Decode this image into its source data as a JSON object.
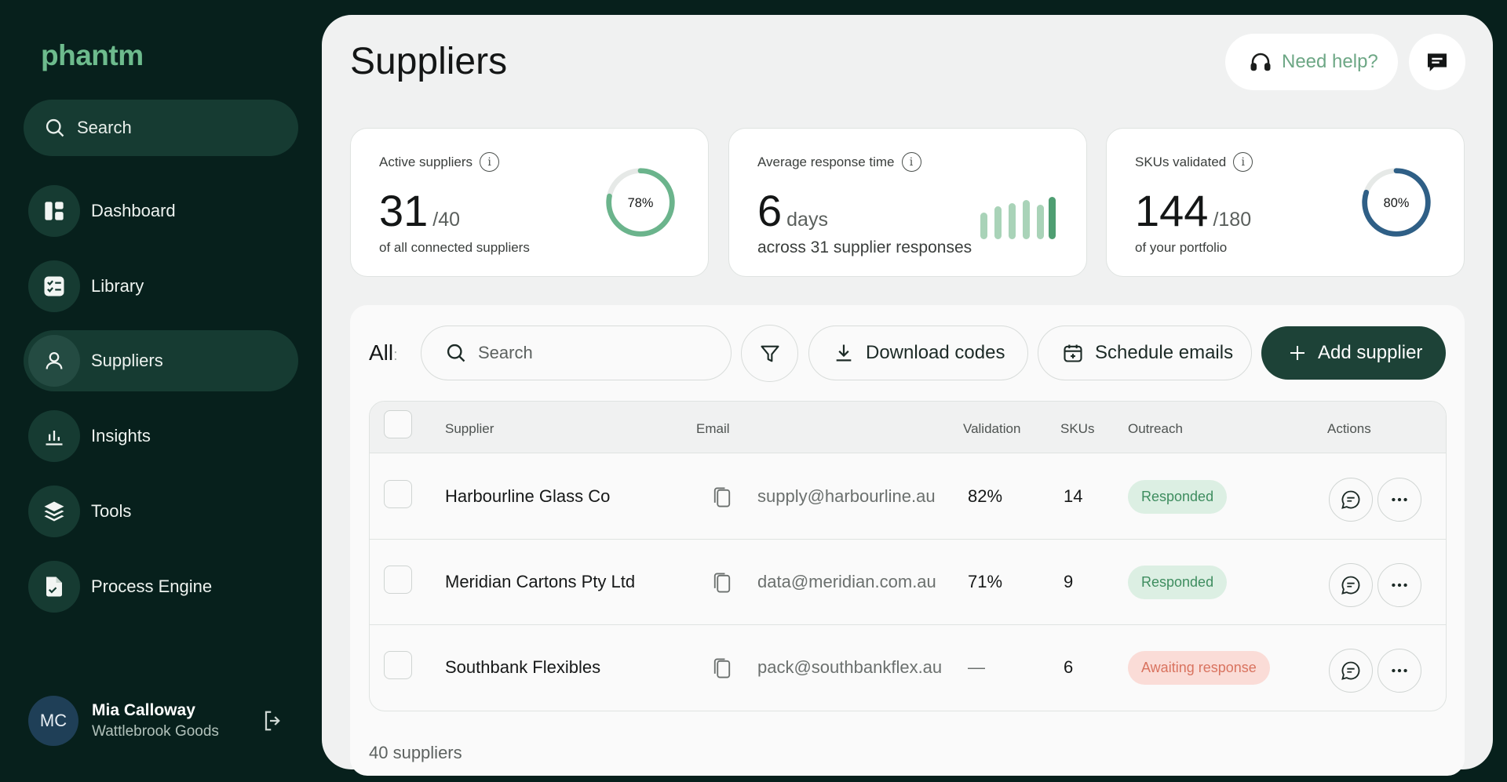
{
  "brand": {
    "logo": "phantm"
  },
  "sidebar": {
    "search_label": "Search",
    "items": [
      {
        "label": "Dashboard",
        "icon": "dashboard-icon"
      },
      {
        "label": "Library",
        "icon": "checklist-icon"
      },
      {
        "label": "Suppliers",
        "icon": "user-icon",
        "active": true
      },
      {
        "label": "Insights",
        "icon": "bar-chart-icon"
      },
      {
        "label": "Tools",
        "icon": "layers-icon"
      },
      {
        "label": "Process Engine",
        "icon": "file-check-icon"
      }
    ],
    "user": {
      "initials": "MC",
      "name": "Mia Calloway",
      "org": "Wattlebrook Goods"
    }
  },
  "header": {
    "title": "Suppliers",
    "help_label": "Need help?"
  },
  "stats": {
    "active": {
      "label": "Active suppliers",
      "value": "31",
      "denom": "/40",
      "sub": "of all connected suppliers",
      "percent_label": "78%",
      "percent": 78
    },
    "response": {
      "label": "Average response time",
      "value": "6",
      "unit": "days",
      "sub": "across 31 supplier responses"
    },
    "skus": {
      "label": "SKUs validated",
      "value": "144",
      "denom": "/180",
      "sub": "of your portfolio",
      "percent_label": "80%",
      "percent": 80
    }
  },
  "toolbar": {
    "filter_label": "All",
    "search_placeholder": "Search",
    "download_label": "Download codes",
    "schedule_label": "Schedule emails",
    "add_label": "Add supplier"
  },
  "table": {
    "headers": {
      "supplier": "Supplier",
      "email": "Email",
      "validation": "Validation",
      "skus": "SKUs",
      "outreach": "Outreach",
      "actions": "Actions"
    },
    "rows": [
      {
        "supplier": "Harbourline Glass Co",
        "email": "supply@harbourline.au",
        "validation": "82%",
        "skus": "14",
        "outreach": "Responded",
        "status": "ok"
      },
      {
        "supplier": "Meridian Cartons Pty Ltd",
        "email": "data@meridian.com.au",
        "validation": "71%",
        "skus": "9",
        "outreach": "Responded",
        "status": "ok"
      },
      {
        "supplier": "Southbank Flexibles",
        "email": "pack@southbankflex.au",
        "validation": "—",
        "skus": "6",
        "outreach": "Awaiting response",
        "status": "wait"
      }
    ],
    "footer": "40 suppliers"
  },
  "colors": {
    "accent": "#6dbb8d",
    "sidebar_bg": "#07201c",
    "primary_button": "#1d4237",
    "donut_green": "#6bb48c",
    "donut_blue": "#2f5f86"
  }
}
